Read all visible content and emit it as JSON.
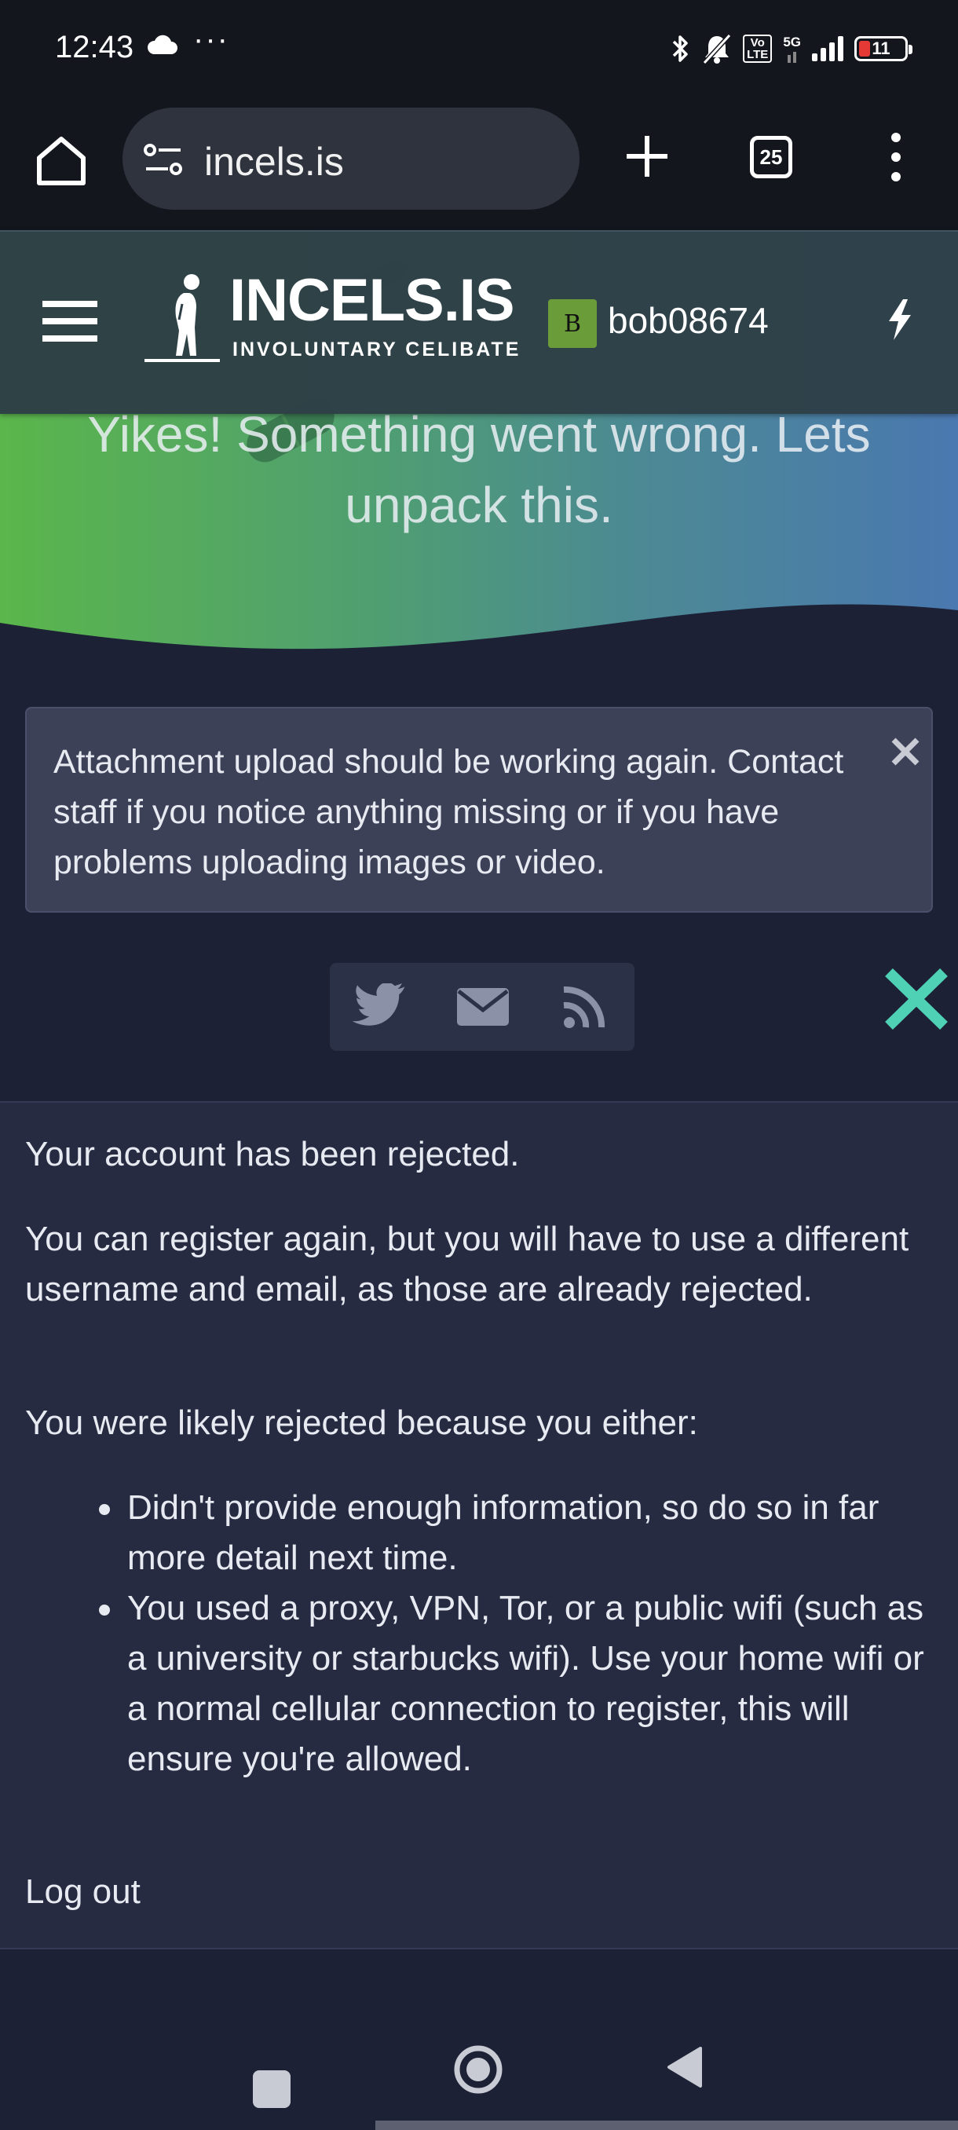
{
  "status_bar": {
    "time": "12:43",
    "overflow": "···",
    "network": "5G",
    "volte": "Vo\nLTE",
    "battery": "11",
    "icons": [
      "cloud-icon",
      "bluetooth-icon",
      "mute-bell-icon",
      "volte-icon",
      "signal-icon",
      "battery-icon"
    ]
  },
  "browser": {
    "url": "incels.is",
    "tab_count": "25",
    "icons": [
      "home-icon",
      "site-settings-icon",
      "new-tab-icon",
      "tabs-icon",
      "more-menu-icon"
    ]
  },
  "site": {
    "logo_title": "INCELS.IS",
    "logo_tagline": "INVOLUNTARY CELIBATE",
    "avatar_letter": "B",
    "username": "bob08674",
    "colors": {
      "hero_start": "#5bb64b",
      "hero_end": "#4a78b0",
      "page_bg": "#1c2136",
      "panel_bg": "#262b42",
      "notice_bg": "#3d4158",
      "accent_x": "#4fd1b5"
    }
  },
  "hero": {
    "title": "Yikes! Something went wrong. Lets unpack this."
  },
  "notice": {
    "text": "Attachment upload should be working again. Contact staff if you notice anything missing or if you have problems uploading images or video."
  },
  "share": {
    "icons": [
      "twitter-icon",
      "email-icon",
      "rss-icon"
    ]
  },
  "content": {
    "p1": "Your account has been rejected.",
    "p2": "You can register again, but you will have to use a different username and email, as those are already rejected.",
    "p3": "You were likely rejected because you either:",
    "reasons": [
      "Didn't provide enough information, so do so in far more detail next time.",
      "You used a proxy, VPN, Tor, or a public wifi (such as a university or starbucks wifi). Use your home wifi or a normal cellular connection to register, this will ensure you're allowed."
    ],
    "logout": "Log out"
  }
}
